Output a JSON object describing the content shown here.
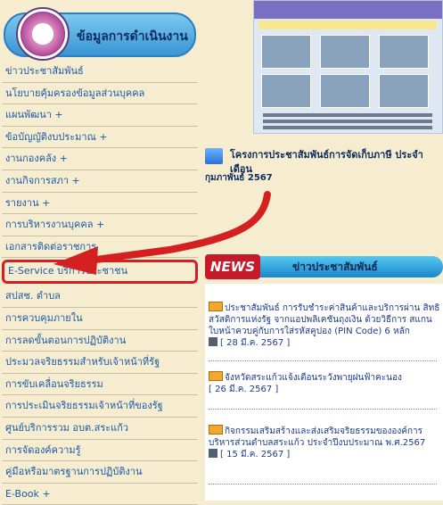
{
  "sidebar": {
    "title": "ข้อมูลการดำเนินงาน",
    "items": [
      {
        "label": "ข่าวประชาสัมพันธ์"
      },
      {
        "label": "นโยบายคุ้มครองข้อมูลส่วนบุคคล"
      },
      {
        "label": "แผนพัฒนา +"
      },
      {
        "label": "ข้อบัญญัติงบประมาณ +"
      },
      {
        "label": "งานกองคลัง +"
      },
      {
        "label": "งานกิจการสภา +"
      },
      {
        "label": "รายงาน +"
      },
      {
        "label": "การบริหารงานบุคคล +"
      },
      {
        "label": "เอกสารติดต่อราชการ"
      },
      {
        "label": "E-Service บริการประชาชน"
      },
      {
        "label": "สปสช. ตำบล"
      },
      {
        "label": "การควบคุมภายใน"
      },
      {
        "label": "การลดขั้นตอนการปฏิบัติงาน"
      },
      {
        "label": "ประมวลจริยธรรมสำหรับเจ้าหน้าที่รัฐ"
      },
      {
        "label": "การขับเคลื่อนจริยธรรม"
      },
      {
        "label": "การประเมินจริยธรรมเจ้าหน้าที่ของรัฐ"
      },
      {
        "label": "ศูนย์บริการรวม อบต.สระแก้ว"
      },
      {
        "label": "การจัดองค์ความรู้"
      },
      {
        "label": "คู่มือหรือมาตรฐานการปฏิบัติงาน"
      },
      {
        "label": "E-Book +"
      }
    ]
  },
  "featured": {
    "title": "โครงการประชาสัมพันธ์การจัดเก็บภาษี ประจำเดือน",
    "date_line": "กุมภาพันธ์ 2567"
  },
  "news": {
    "badge": "NEWS",
    "heading": "ข่าวประชาสัมพันธ์",
    "items": [
      {
        "text": "ประชาสัมพันธ์ การรับชำระค่าสินค้าและบริการผ่าน สิทธิสวัสดิการแห่งรัฐ จากแอปพลิเคชันถุงเงิน ด้วยวิธีการ สแกนใบหน้าควบคู่กับการใส่รหัสคูปอง (PIN Code) 6 หลัก",
        "date": "[ 28 มี.ค. 2567 ]"
      },
      {
        "text": "จังหวัดสระแก้วแจ้งเตือนระวังพายุฝนฟ้าคะนอง",
        "date": "[ 26 มี.ค. 2567 ]"
      },
      {
        "text": "กิจกรรมเสริมสร้างและส่งเสริมจริยธรรมขององค์การ บริหารส่วนตำบลสระแก้ว ประจำปีงบประมาณ พ.ศ.2567",
        "date": "[ 15 มี.ค. 2567 ]"
      }
    ]
  },
  "colors": {
    "highlight": "#d42020",
    "link": "#1b5aa8",
    "background": "#f6eccf"
  }
}
